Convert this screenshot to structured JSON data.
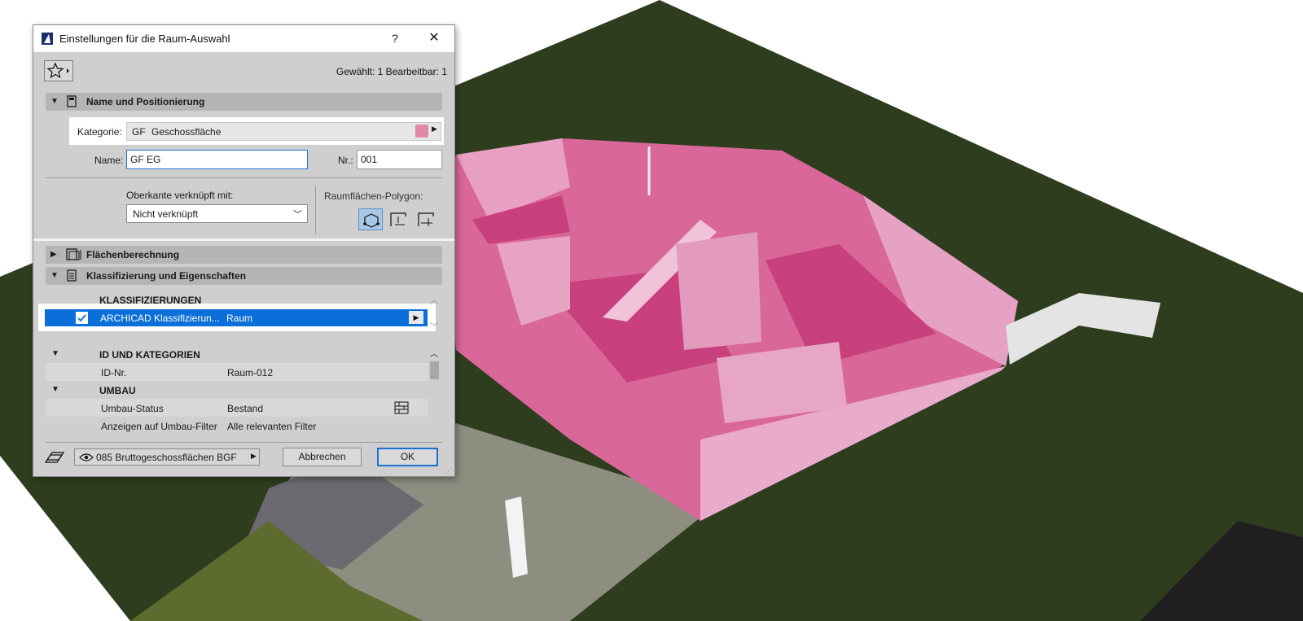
{
  "dialog": {
    "title": "Einstellungen für die Raum-Auswahl",
    "help_label": "?",
    "close_label": "✕",
    "selection_info": "Gewählt: 1 Bearbeitbar: 1"
  },
  "section_name": {
    "title": "Name und Positionierung",
    "kategorie_label": "Kategorie:",
    "kategorie_code": "GF",
    "kategorie_name": "Geschossfläche",
    "kategorie_color": "#e08aa8",
    "name_label": "Name:",
    "name_value": "GF EG",
    "nr_label": "Nr.:",
    "nr_value": "001",
    "oberkante_label": "Oberkante verknüpft mit:",
    "oberkante_value": "Nicht verknüpft",
    "polygon_label": "Raumflächen-Polygon:"
  },
  "section_flaeche": {
    "title": "Flächenberechnung"
  },
  "section_klass": {
    "title": "Klassifizierung und Eigenschaften",
    "klass_header": "KLASSIFIZIERUNGEN",
    "klass_row": {
      "name": "ARCHICAD Klassifizierun...",
      "value": "Raum",
      "checked": true
    },
    "groups": [
      {
        "title": "ID UND KATEGORIEN",
        "rows": [
          {
            "name": "ID-Nr.",
            "value": "Raum-012"
          }
        ]
      },
      {
        "title": "UMBAU",
        "rows": [
          {
            "name": "Umbau-Status",
            "value": "Bestand"
          },
          {
            "name": "Anzeigen auf Umbau-Filter",
            "value": "Alle relevanten Filter"
          }
        ]
      }
    ]
  },
  "footer": {
    "view_label": "085 Bruttogeschossflächen BGF",
    "cancel_label": "Abbrechen",
    "ok_label": "OK"
  },
  "colors": {
    "accent": "#0a6fd8",
    "room": "#d9679a",
    "lawn": "#2f3d1f"
  }
}
